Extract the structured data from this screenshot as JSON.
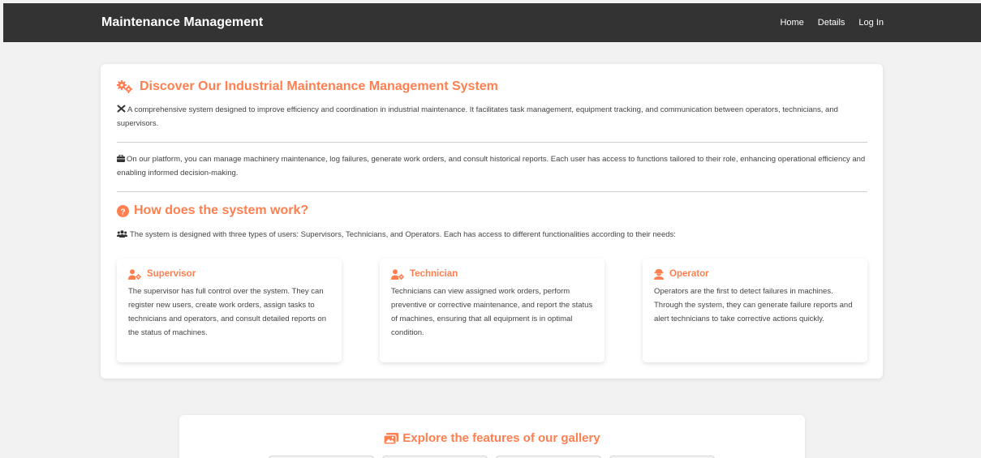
{
  "header": {
    "brand": "Maintenance Management",
    "nav": [
      {
        "label": "Home"
      },
      {
        "label": "Details"
      },
      {
        "label": "Log In"
      }
    ]
  },
  "intro": {
    "title": "Discover Our Industrial Maintenance Management System",
    "title_icon": "gears-icon",
    "paragraph1": "A comprehensive system designed to improve efficiency and coordination in industrial maintenance. It facilitates task management, equipment tracking, and communication between operators, technicians, and supervisors.",
    "paragraph1_icon": "tools-icon",
    "paragraph2": "On our platform, you can manage machinery maintenance, log failures, generate work orders, and consult historical reports. Each user has access to functions tailored to their role, enhancing operational efficiency and enabling informed decision-making.",
    "paragraph2_icon": "briefcase-icon"
  },
  "how": {
    "title": "How does the system work?",
    "title_icon": "question-circle-icon",
    "paragraph": "The system is designed with three types of users: Supervisors, Technicians, and Operators. Each has access to different functionalities according to their needs:",
    "paragraph_icon": "users-icon"
  },
  "roles": [
    {
      "title": "Supervisor",
      "icon": "user-cog-icon",
      "description": "The supervisor has full control over the system. They can register new users, create work orders, assign tasks to technicians and operators, and consult detailed reports on the status of machines."
    },
    {
      "title": "Technician",
      "icon": "user-cog-icon",
      "description": "Technicians can view assigned work orders, perform preventive or corrective maintenance, and report the status of machines, ensuring that all equipment is in optimal condition."
    },
    {
      "title": "Operator",
      "icon": "user-hardhat-icon",
      "description": "Operators are the first to detect failures in machines. Through the system, they can generate failure reports and alert technicians to take corrective actions quickly."
    }
  ],
  "gallery": {
    "title": "Explore the features of our gallery",
    "title_icon": "images-icon"
  },
  "colors": {
    "accent": "#ff7f50",
    "topbar": "#333333",
    "background": "#f2f2f2",
    "text": "#444444"
  }
}
